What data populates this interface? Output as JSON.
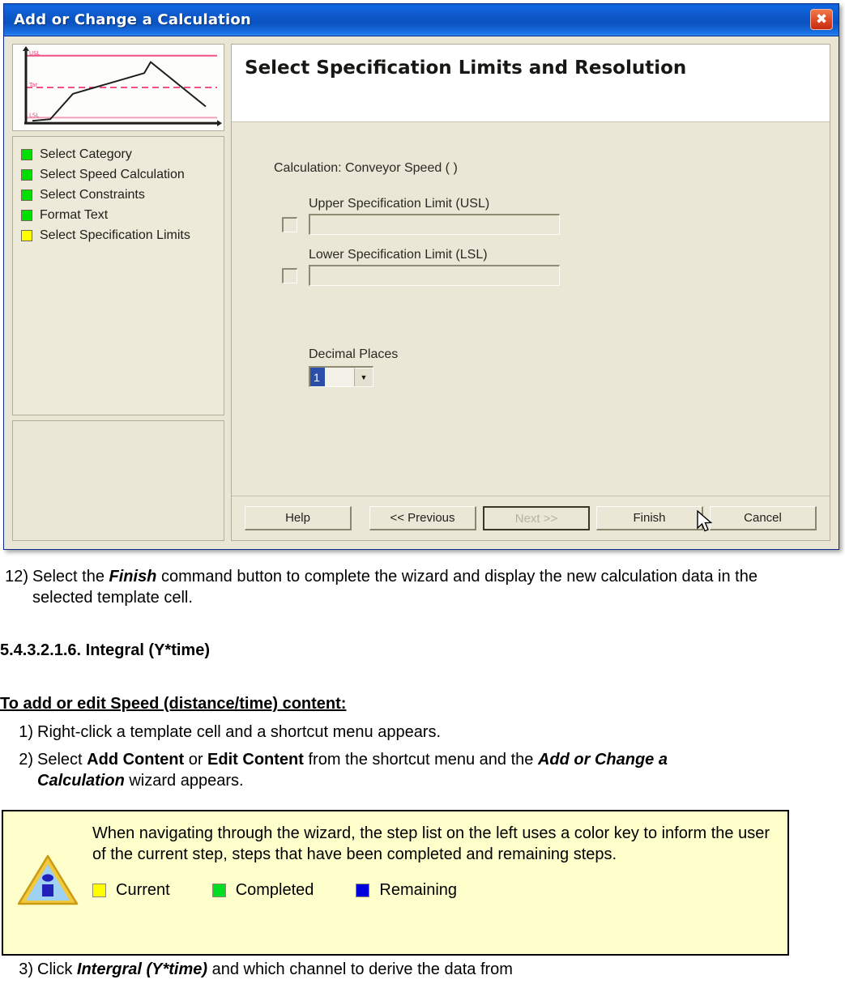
{
  "dialog": {
    "title": "Add or Change a Calculation",
    "close_icon": "close-icon",
    "panel_title": "Select Specification Limits and Resolution",
    "calculation_line": "Calculation: Conveyor Speed ( )",
    "usl": {
      "label": "Upper Specification Limit (USL)",
      "value": "",
      "checked": false
    },
    "lsl": {
      "label": "Lower Specification Limit (LSL)",
      "value": "",
      "checked": false
    },
    "decimal_places": {
      "label": "Decimal Places",
      "value": "1"
    },
    "steps": [
      {
        "label": "Select Category",
        "color": "#00e000",
        "state": "completed"
      },
      {
        "label": "Select Speed Calculation",
        "color": "#00e000",
        "state": "completed"
      },
      {
        "label": "Select Constraints",
        "color": "#00e000",
        "state": "completed"
      },
      {
        "label": "Format Text",
        "color": "#00e000",
        "state": "completed"
      },
      {
        "label": "Select Specification Limits",
        "color": "#ffff00",
        "state": "current"
      }
    ],
    "buttons": {
      "help": "Help",
      "previous": "<< Previous",
      "next": "Next >>",
      "finish": "Finish",
      "cancel": "Cancel"
    }
  },
  "document": {
    "step12": {
      "number": "12)",
      "prefix": "Select the ",
      "bold": "Finish",
      "suffix": " command button to complete the wizard and display the new calculation data in the selected template cell."
    },
    "section_heading": "5.4.3.2.1.6. Integral (Y*time)",
    "procedure_heading": "To add or edit Speed (distance/time) content:",
    "steps": [
      {
        "number": "1)",
        "parts": [
          {
            "text": "Right-click a template cell and a shortcut menu appears.",
            "style": "normal"
          }
        ]
      },
      {
        "number": "2)",
        "parts": [
          {
            "text": "Select ",
            "style": "normal"
          },
          {
            "text": "Add Content",
            "style": "bold"
          },
          {
            "text": " or ",
            "style": "normal"
          },
          {
            "text": "Edit Content",
            "style": "bold"
          },
          {
            "text": " from the shortcut menu and the ",
            "style": "normal"
          },
          {
            "text": "Add or Change a Calculation",
            "style": "bolditalic"
          },
          {
            "text": " wizard appears.",
            "style": "normal"
          }
        ]
      }
    ],
    "step3": {
      "number": "3)",
      "prefix": "Click ",
      "bold": "Intergral (Y*time)",
      "suffix": " and which channel to derive the data from"
    }
  },
  "note": {
    "icon": "info-triangle-icon",
    "text": "When navigating through the wizard, the step list on the left uses a color key to inform the user of the current step, steps that have been completed and remaining steps.",
    "legend": [
      {
        "label": "Current",
        "color": "#ffff00"
      },
      {
        "label": "Completed",
        "color": "#00dd22"
      },
      {
        "label": "Remaining",
        "color": "#0000dd"
      }
    ]
  }
}
